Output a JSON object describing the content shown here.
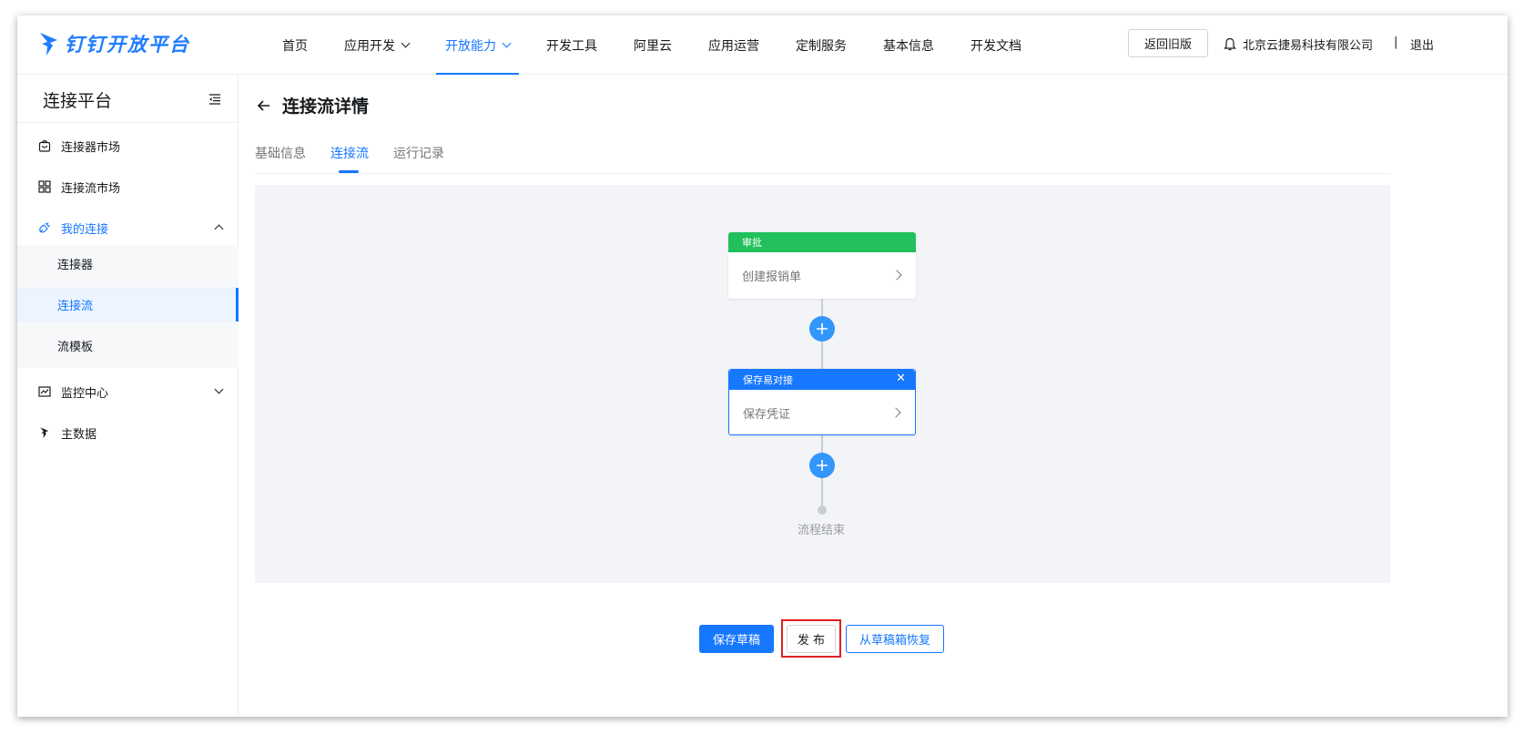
{
  "header": {
    "logo_text": "钉钉开放平台",
    "nav": [
      {
        "label": "首页"
      },
      {
        "label": "应用开发"
      },
      {
        "label": "开放能力"
      },
      {
        "label": "开发工具"
      },
      {
        "label": "阿里云"
      },
      {
        "label": "应用运营"
      },
      {
        "label": "定制服务"
      },
      {
        "label": "基本信息"
      },
      {
        "label": "开发文档"
      }
    ],
    "old_version_label": "返回旧版",
    "company": "北京云捷易科技有限公司",
    "separator": "|",
    "logout_label": "退出"
  },
  "sidebar": {
    "title": "连接平台",
    "items": [
      {
        "label": "连接器市场"
      },
      {
        "label": "连接流市场"
      },
      {
        "label": "我的连接"
      },
      {
        "label": "监控中心"
      },
      {
        "label": "主数据"
      }
    ],
    "sub_items": [
      {
        "label": "连接器"
      },
      {
        "label": "连接流"
      },
      {
        "label": "流模板"
      }
    ]
  },
  "main": {
    "title": "连接流详情",
    "tabs": [
      {
        "label": "基础信息"
      },
      {
        "label": "连接流"
      },
      {
        "label": "运行记录"
      }
    ],
    "flow": {
      "node1": {
        "header": "审批",
        "body": "创建报销单",
        "color": "#21c05c"
      },
      "node2": {
        "header": "保存易对接",
        "body": "保存凭证",
        "color": "#1677ff"
      },
      "end_label": "流程结束"
    },
    "buttons": {
      "save_draft": "保存草稿",
      "publish": "发 布",
      "restore": "从草稿箱恢复"
    }
  },
  "colors": {
    "accent": "#1677ff",
    "approval_green": "#21c05c",
    "highlight_red": "#e02020"
  }
}
